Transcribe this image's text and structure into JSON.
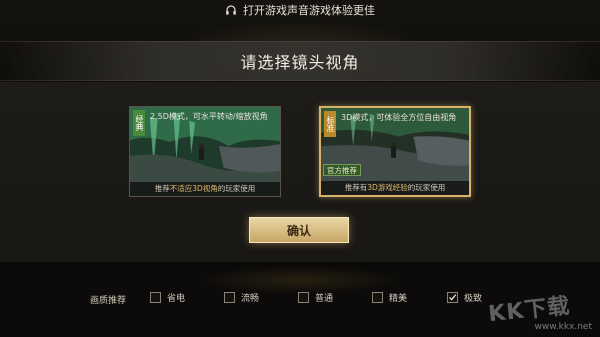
{
  "hint": {
    "text": "打开游戏声音游戏体验更佳",
    "icon": "headphones-icon"
  },
  "title": "请选择镜头视角",
  "modes": [
    {
      "tag": "经典",
      "description": "2.5D模式，可水平转动/缩放视角",
      "footer_prefix": "推荐",
      "footer_highlight": "不适应3D视角",
      "footer_suffix": "的玩家使用",
      "selected": false,
      "tag_color": "#4b8a3a"
    },
    {
      "tag": "标准",
      "description": "3D模式，可体验全方位自由视角",
      "footer_prefix": "推荐有",
      "footer_highlight": "3D游戏经验",
      "footer_suffix": "的玩家使用",
      "badge": "官方推荐",
      "selected": true,
      "tag_color": "#b88a2e"
    }
  ],
  "confirm_label": "确认",
  "quality": {
    "label": "画质推荐",
    "options": [
      {
        "label": "省电",
        "checked": false
      },
      {
        "label": "流畅",
        "checked": false
      },
      {
        "label": "普通",
        "checked": false
      },
      {
        "label": "精美",
        "checked": false
      },
      {
        "label": "极致",
        "checked": true
      }
    ]
  },
  "watermark": {
    "text": "KK下载",
    "url": "www.kkx.net"
  },
  "colors": {
    "accent": "#d9b26a",
    "button": "#d8bd82",
    "highlight": "#e2b86a"
  }
}
